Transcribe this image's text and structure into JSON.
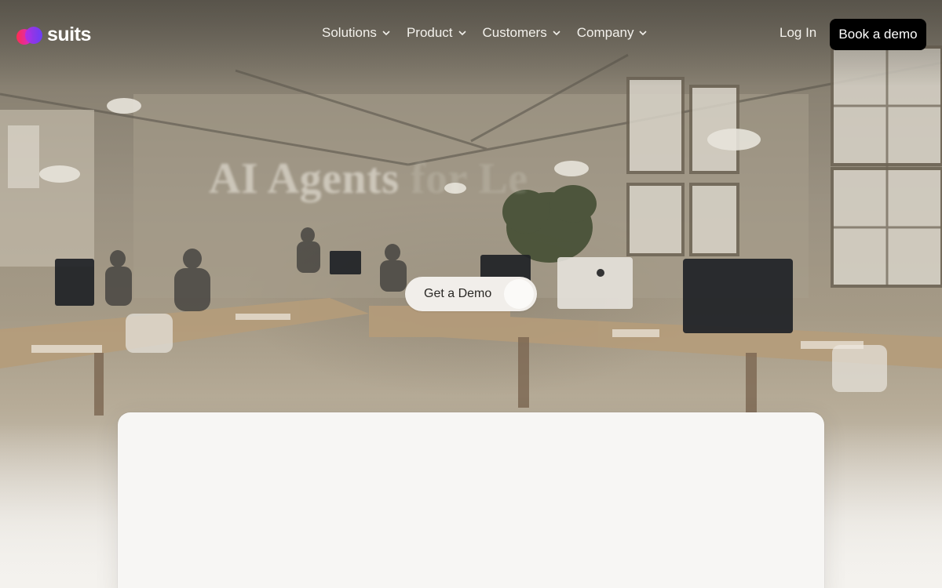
{
  "brand": {
    "name": "suits",
    "colors": {
      "pink": "#ff2d6f",
      "purple": "#7a3cff",
      "magenta": "#d12bd6"
    }
  },
  "nav": {
    "items": [
      {
        "label": "Solutions",
        "icon": "chevron-down-icon"
      },
      {
        "label": "Product",
        "icon": "chevron-down-icon"
      },
      {
        "label": "Customers",
        "icon": "chevron-down-icon"
      },
      {
        "label": "Company",
        "icon": "chevron-down-icon"
      }
    ],
    "login_label": "Log In",
    "cta_label": "Book a demo"
  },
  "hero": {
    "title_visible": "AI Agents",
    "title_faded": "for Le",
    "cta_label": "Get a Demo"
  },
  "colors": {
    "cta_bg": "#000000",
    "demo_btn_bg": "#f1eeea",
    "card_bg": "#f7f6f4"
  }
}
